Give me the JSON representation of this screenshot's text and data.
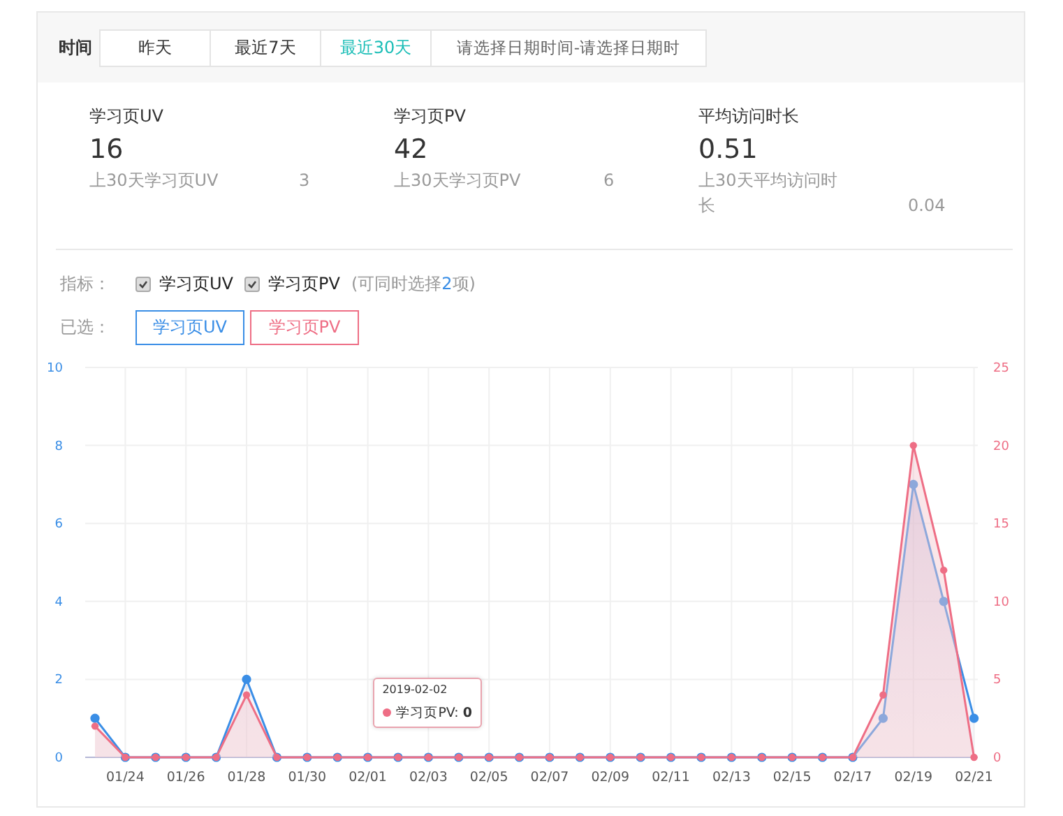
{
  "filter": {
    "label": "时间",
    "tabs": [
      {
        "label": "昨天",
        "selected": false
      },
      {
        "label": "最近7天",
        "selected": false
      },
      {
        "label": "最近30天",
        "selected": true
      }
    ],
    "date_range": {
      "start_placeholder": "请选择日期时间",
      "separator": "-",
      "end_placeholder": "请选择日期时"
    }
  },
  "metrics": [
    {
      "label": "学习页UV",
      "value": "16",
      "prev_label": "上30天学习页UV",
      "prev_value": "3"
    },
    {
      "label": "学习页PV",
      "value": "42",
      "prev_label": "上30天学习页PV",
      "prev_value": "6"
    },
    {
      "label": "平均访问时长",
      "value": "0.51",
      "prev_label": "上30天平均访问时长",
      "prev_value": "0.04"
    }
  ],
  "indicators": {
    "label": "指标：",
    "options": [
      {
        "label": "学习页UV",
        "checked": true
      },
      {
        "label": "学习页PV",
        "checked": true
      }
    ],
    "hint_before": "(可同时选择",
    "hint_count": "2",
    "hint_after": "项)"
  },
  "selected": {
    "label": "已选："
  },
  "chart": {
    "uv_axis": {
      "chart_data": {
        "type": "area",
        "grid": true,
        "categories": [
          null,
          "01/24",
          null,
          "01/26",
          null,
          "01/28",
          null,
          "01/30",
          null,
          "02/01",
          null,
          "02/03",
          null,
          "02/05",
          null,
          "02/07",
          null,
          "02/09",
          null,
          "02/11",
          null,
          "02/13",
          null,
          "02/15",
          null,
          "02/17",
          null,
          "02/19",
          null,
          "02/21"
        ],
        "series": [
          {
            "name": "学习页UV",
            "color": "#3a8ee6",
            "values": [
              1,
              0,
              0,
              0,
              0,
              2,
              0,
              0,
              0,
              0,
              0,
              0,
              0,
              0,
              0,
              0,
              0,
              0,
              0,
              0,
              0,
              0,
              0,
              0,
              0,
              0,
              1,
              7,
              4,
              1
            ]
          }
        ],
        "ylim": [
          0,
          10
        ],
        "yticks": [
          0,
          2,
          4,
          6,
          8,
          10
        ]
      }
    },
    "pv_axis": {
      "chart_data": {
        "type": "area",
        "categories": [
          null,
          null,
          null,
          null,
          null,
          null,
          null,
          null,
          null,
          null,
          null,
          null,
          null,
          null,
          null,
          null,
          null,
          null,
          null,
          null,
          null,
          null,
          null,
          null,
          null,
          null,
          null,
          null,
          null,
          null
        ],
        "series": [
          {
            "name": "学习页PV",
            "color": "#ee6e85",
            "values": [
              2,
              0,
              0,
              0,
              0,
              4,
              0,
              0,
              0,
              0,
              0,
              0,
              0,
              0,
              0,
              0,
              0,
              0,
              0,
              0,
              0,
              0,
              0,
              0,
              0,
              0,
              4,
              20,
              12,
              0
            ]
          }
        ],
        "ylim": [
          0,
          25
        ],
        "yticks": [
          0,
          5,
          10,
          15,
          20,
          25
        ]
      }
    },
    "tooltip": {
      "title": "2019-02-02",
      "text": "学习页PV: **0**"
    }
  }
}
